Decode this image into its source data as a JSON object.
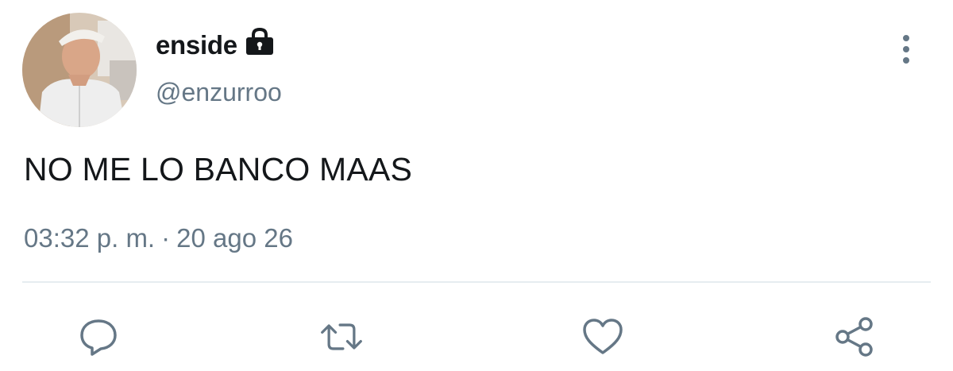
{
  "tweet": {
    "display_name": "enside",
    "handle": "@enzurroo",
    "text": "NO ME LO BANCO MAAS",
    "time": "03:32 p. m.",
    "separator": "·",
    "date": "20 ago 26",
    "protected_icon": "lock-icon",
    "more_icon": "vertical-ellipsis-icon"
  },
  "actions": [
    {
      "name": "reply",
      "icon": "reply-icon"
    },
    {
      "name": "retweet",
      "icon": "retweet-icon"
    },
    {
      "name": "like",
      "icon": "heart-icon"
    },
    {
      "name": "share",
      "icon": "share-icon"
    }
  ],
  "colors": {
    "text_primary": "#14171a",
    "text_secondary": "#657786",
    "divider": "#e6ecf0",
    "background": "#ffffff"
  }
}
